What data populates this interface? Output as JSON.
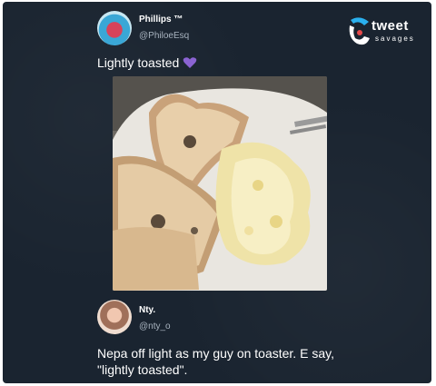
{
  "brand": {
    "line1": "tweet",
    "line2": "savages"
  },
  "tweet1": {
    "name": "Phillips ™",
    "handle": "@PhiloeEsq",
    "text": "Lightly toasted",
    "emoji": "purple-heart-icon",
    "image": "photo of bread slices with holes and scrambled eggs on a plate"
  },
  "tweet2": {
    "name": "Nty.",
    "handle": "@nty_o",
    "text_line1": "Nepa off light as my guy on toaster. E say,",
    "text_line2": "\"lightly toasted\"."
  },
  "colors": {
    "background": "#1a2430",
    "text": "#ffffff",
    "handle": "#a8b3bf",
    "accent": "#8a63d2"
  }
}
